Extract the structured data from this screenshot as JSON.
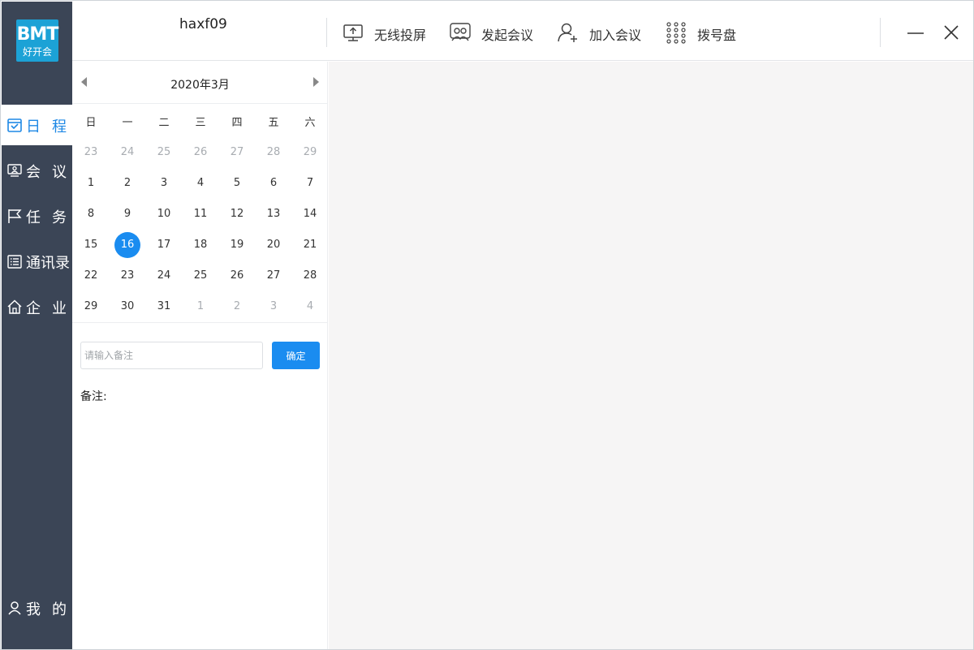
{
  "app": {
    "logo_text": "好开会",
    "logo_mark": "BMT",
    "username": "haxf09"
  },
  "sidebar": {
    "items": [
      {
        "label": "日程",
        "icon": "calendar-icon",
        "active": true
      },
      {
        "label": "会议",
        "icon": "meeting-icon",
        "active": false
      },
      {
        "label": "任务",
        "icon": "flag-icon",
        "active": false
      },
      {
        "label": "通讯录",
        "icon": "contacts-icon",
        "active": false
      },
      {
        "label": "企业",
        "icon": "home-icon",
        "active": false
      }
    ],
    "profile": {
      "label": "我的",
      "icon": "user-icon"
    }
  },
  "toolbar": {
    "items": [
      {
        "label": "无线投屏",
        "icon": "screen-cast-icon"
      },
      {
        "label": "发起会议",
        "icon": "start-meeting-icon"
      },
      {
        "label": "加入会议",
        "icon": "join-meeting-icon"
      },
      {
        "label": "拨号盘",
        "icon": "dialpad-icon"
      }
    ],
    "minimize_icon": "minimize-icon",
    "close_icon": "close-icon"
  },
  "calendar": {
    "title": "2020年3月",
    "weekdays": [
      "日",
      "一",
      "二",
      "三",
      "四",
      "五",
      "六"
    ],
    "weeks": [
      [
        "23",
        "24",
        "25",
        "26",
        "27",
        "28",
        "29"
      ],
      [
        "1",
        "2",
        "3",
        "4",
        "5",
        "6",
        "7"
      ],
      [
        "8",
        "9",
        "10",
        "11",
        "12",
        "13",
        "14"
      ],
      [
        "15",
        "16",
        "17",
        "18",
        "19",
        "20",
        "21"
      ],
      [
        "22",
        "23",
        "24",
        "25",
        "26",
        "27",
        "28"
      ],
      [
        "29",
        "30",
        "31",
        "1",
        "2",
        "3",
        "4"
      ]
    ],
    "selected": "16",
    "prev_icon": "caret-left-icon",
    "next_icon": "caret-right-icon"
  },
  "note": {
    "placeholder": "请输入备注",
    "value": "",
    "confirm_label": "确定",
    "label": "备注:"
  },
  "colors": {
    "sidebar_bg": "#3b4556",
    "accent": "#1a8cf0",
    "content_bg": "#f6f5f5"
  }
}
